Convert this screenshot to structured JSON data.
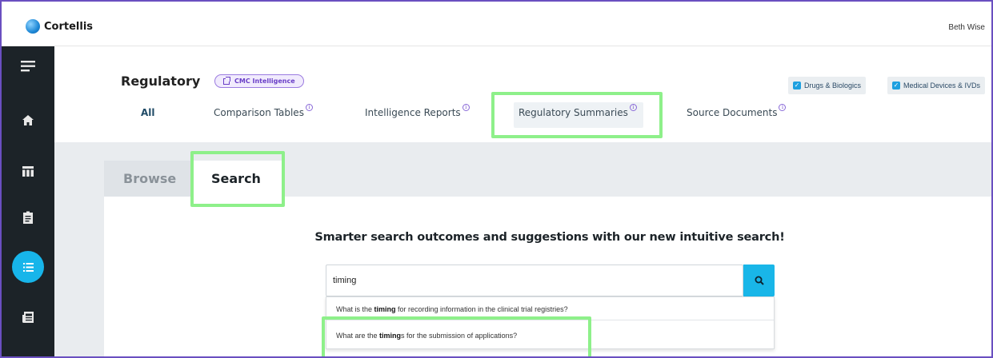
{
  "app": {
    "logo_text": "Cortellis",
    "user_name": "Beth Wise"
  },
  "header": {
    "title": "Regulatory",
    "cmc_badge": "CMC Intelligence",
    "filters": [
      {
        "label": "Drugs & Biologics",
        "checked": true
      },
      {
        "label": "Medical Devices & IVDs",
        "checked": true
      }
    ],
    "tabs": [
      {
        "label": "All",
        "info": false
      },
      {
        "label": "Comparison Tables",
        "info": true
      },
      {
        "label": "Intelligence Reports",
        "info": true
      },
      {
        "label": "Regulatory Summaries",
        "info": true
      },
      {
        "label": "Source Documents",
        "info": true
      }
    ],
    "active_tab": "Regulatory Summaries"
  },
  "subtabs": {
    "browse": "Browse",
    "search": "Search",
    "active": "Search"
  },
  "search": {
    "promo": "Smarter search outcomes and suggestions with our new intuitive search!",
    "value": "timing",
    "suggestions": [
      {
        "before": "What is the ",
        "bold": "timing",
        "after": " for recording information in the clinical trial registries?"
      },
      {
        "before": "What are the ",
        "bold": "timing",
        "after": "s for the submission of  applications?"
      }
    ]
  },
  "sidebar": {
    "items": [
      "menu-icon",
      "home-icon",
      "table-icon",
      "clipboard-icon",
      "list-icon",
      "newspaper-icon"
    ],
    "active": "list-icon"
  },
  "colors": {
    "accent": "#17b5ea",
    "highlight": "#8ef08a",
    "sidebar": "#1c2328",
    "badge": "#6a3fc7"
  }
}
